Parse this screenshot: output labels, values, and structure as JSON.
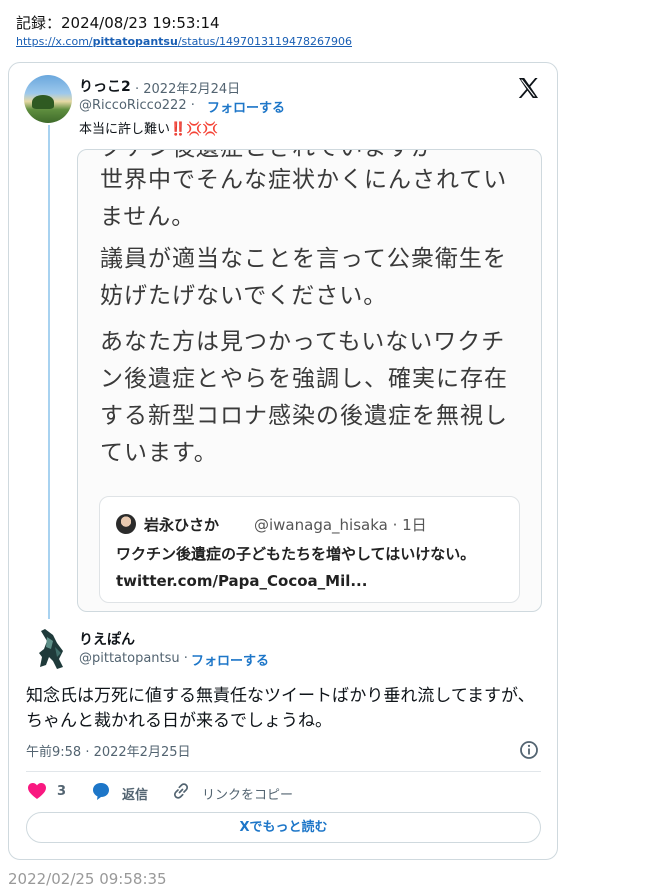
{
  "record": {
    "label": "記録：2024/08/23 19:53:14"
  },
  "source_url": {
    "prefix": "https://x.com/",
    "user": "pittatopantsu",
    "suffix": "/status/1497013119478267906"
  },
  "parent_tweet": {
    "name": "りっこ2",
    "date": "· 2022年2月24日",
    "handle": "@RiccoRicco222 ·",
    "follow": "フォローする",
    "text": "本当に許し難い‼️💢💢",
    "image_text": {
      "cut_line": "クチン後遺症とされていますが",
      "para1": "世界中でそんな症状かくにんされていません。",
      "para2": "議員が適当なことを言って公衆衛生を妨げたげないでください。",
      "para3": "あなた方は見つかってもいないワクチン後遺症とやらを強調し、確実に存在する新型コロナ感染の後遺症を無視しています。"
    },
    "quote": {
      "name": "岩永ひさか",
      "handle": "@iwanaga_hisaka · 1日",
      "text": "ワクチン後遺症の子どもたちを増やしてはいけない。 twitter.com/Papa_Cocoa_Mil..."
    }
  },
  "main_tweet": {
    "name": "りえぽん",
    "handle": "@pittatopantsu ·",
    "follow": "フォローする",
    "text": "知念氏は万死に値する無責任なツイートばかり垂れ流してますが、ちゃんと裁かれる日が来るでしょうね。",
    "time": "午前9:58 · 2022年2月25日"
  },
  "actions": {
    "like_count": "3",
    "reply_label": "返信",
    "copy_link_label": "リンクをコピー",
    "read_more_label": "Xでもっと読む"
  },
  "footer": {
    "timestamp": "2022/02/25 09:58:35"
  },
  "colors": {
    "accent": "#1d76c8",
    "like": "#f91880",
    "text": "#0f1419",
    "muted": "#536471"
  },
  "icons": [
    "x-logo-icon",
    "heart-icon",
    "reply-bubble-icon",
    "link-icon",
    "info-icon"
  ]
}
